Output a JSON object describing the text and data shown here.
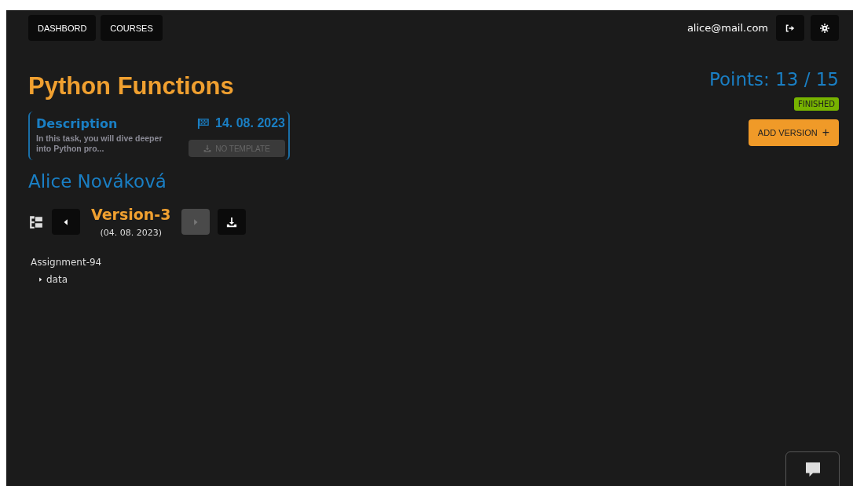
{
  "nav": [
    {
      "label": "DASHBORD"
    },
    {
      "label": "COURSES"
    }
  ],
  "user": {
    "email": "alice@mail.com"
  },
  "task": {
    "title": "Python Functions",
    "description_heading": "Description",
    "description": "In this task, you will dive deeper into Python pro...",
    "deadline": "14. 08. 2023",
    "template_button": {
      "label": "NO TEMPLATE",
      "disabled": true
    }
  },
  "points": "Points: 13 / 15",
  "status": {
    "label": "FINISHED"
  },
  "add_version": {
    "label": "ADD VERSION",
    "icon": "+"
  },
  "student": "Alice Nováková",
  "version": {
    "name": "Version-3",
    "date": "(04. 08. 2023)",
    "prev_disabled": false,
    "next_disabled": true
  },
  "tree": [
    {
      "name": "Assignment-94",
      "children": [
        {
          "name": "data",
          "expanded": false
        }
      ]
    }
  ]
}
